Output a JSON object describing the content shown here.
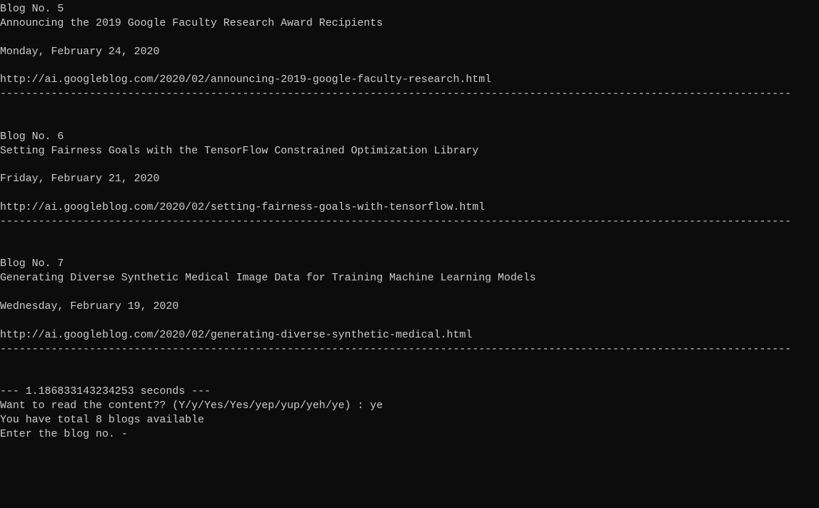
{
  "blogs": [
    {
      "heading": "Blog No. 5",
      "title": "Announcing the 2019 Google Faculty Research Award Recipients",
      "date": "Monday, February 24, 2020",
      "url": "http://ai.googleblog.com/2020/02/announcing-2019-google-faculty-research.html"
    },
    {
      "heading": "Blog No. 6",
      "title": "Setting Fairness Goals with the TensorFlow Constrained Optimization Library",
      "date": "Friday, February 21, 2020",
      "url": "http://ai.googleblog.com/2020/02/setting-fairness-goals-with-tensorflow.html"
    },
    {
      "heading": "Blog No. 7",
      "title": "Generating Diverse Synthetic Medical Image Data for Training Machine Learning Models",
      "date": "Wednesday, February 19, 2020",
      "url": "http://ai.googleblog.com/2020/02/generating-diverse-synthetic-medical.html"
    }
  ],
  "separator": "----------------------------------------------------------------------------------------------------------------------------",
  "footer": {
    "timing": "--- 1.186833143234253 seconds ---",
    "prompt_read": "Want to read the content?? (Y/y/Yes/Yes/yep/yup/yeh/ye) : ye",
    "total": "You have total 8 blogs available",
    "prompt_blog": "Enter the blog no. -"
  }
}
